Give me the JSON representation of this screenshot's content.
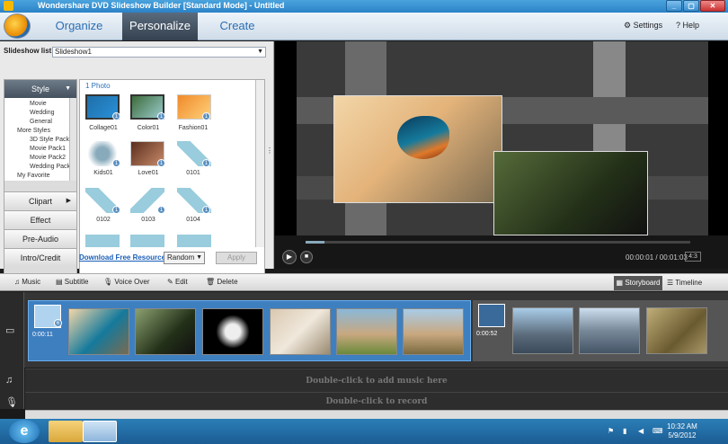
{
  "window": {
    "title": "Wondershare DVD Slideshow Builder [Standard Mode] - Untitled",
    "min": "_",
    "max": "▢",
    "close": "✕"
  },
  "nav": {
    "tabs": [
      "Organize",
      "Personalize",
      "Create"
    ],
    "active": "Personalize",
    "settings": "Settings",
    "help": "Help"
  },
  "slideshow": {
    "label": "Slideshow list :",
    "value": "Slideshow1"
  },
  "style_panel": {
    "header": "Style",
    "tree": [
      "Movie",
      "Wedding",
      "General",
      "More Styles",
      "3D Style Pack",
      "Movie Pack1",
      "Movie Pack2",
      "Wedding Pack",
      "My Favorite"
    ],
    "categories": [
      "Clipart",
      "Effect",
      "Pre-Audio",
      "Intro/Credit"
    ]
  },
  "gallery": {
    "count": "1 Photo",
    "items": [
      "Collage01",
      "Color01",
      "Fashion01",
      "Kids01",
      "Love01",
      "0101",
      "0102",
      "0103",
      "0104"
    ],
    "badge": "1"
  },
  "actions": {
    "download": "Download Free Resource",
    "random": "Random",
    "apply": "Apply"
  },
  "player": {
    "time": "00:00:01 / 00:01:03",
    "ratio": "4:3",
    "progress": 0.05
  },
  "toolbar": {
    "music": "Music",
    "subtitle": "Subtitle",
    "voice": "Voice Over",
    "edit": "Edit",
    "delete": "Delete",
    "storyboard": "Storyboard",
    "timeline": "Timeline"
  },
  "timeline": {
    "seg1_duration": "0:00:11",
    "seg2_duration": "0:00:52",
    "badge": "6"
  },
  "tracks": {
    "music_hint": "Double-click to add music here",
    "record_hint": "Double-click to record"
  },
  "taskbar": {
    "time": "10:32 AM",
    "date": "5/9/2012"
  },
  "colors": {
    "accent": "#2b82c7",
    "selected_segment": "#3e7fc0"
  }
}
